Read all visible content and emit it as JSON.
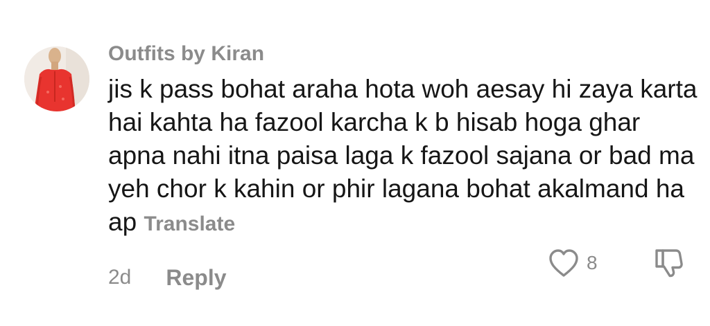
{
  "comment": {
    "username": "Outfits by Kiran",
    "text": "jis k pass bohat araha hota woh aesay hi zaya karta hai kahta ha fazool karcha k b hisab hoga ghar apna nahi itna paisa laga k fazool sajana or bad ma yeh chor k kahin or phir lagana bohat akalmand ha ap",
    "translate_label": "Translate",
    "timestamp": "2d",
    "reply_label": "Reply",
    "like_count": "8"
  },
  "icons": {
    "like": "heart-icon",
    "dislike": "thumbs-down-icon"
  },
  "colors": {
    "text": "#161616",
    "muted": "#8b8b8b",
    "background": "#ffffff"
  }
}
